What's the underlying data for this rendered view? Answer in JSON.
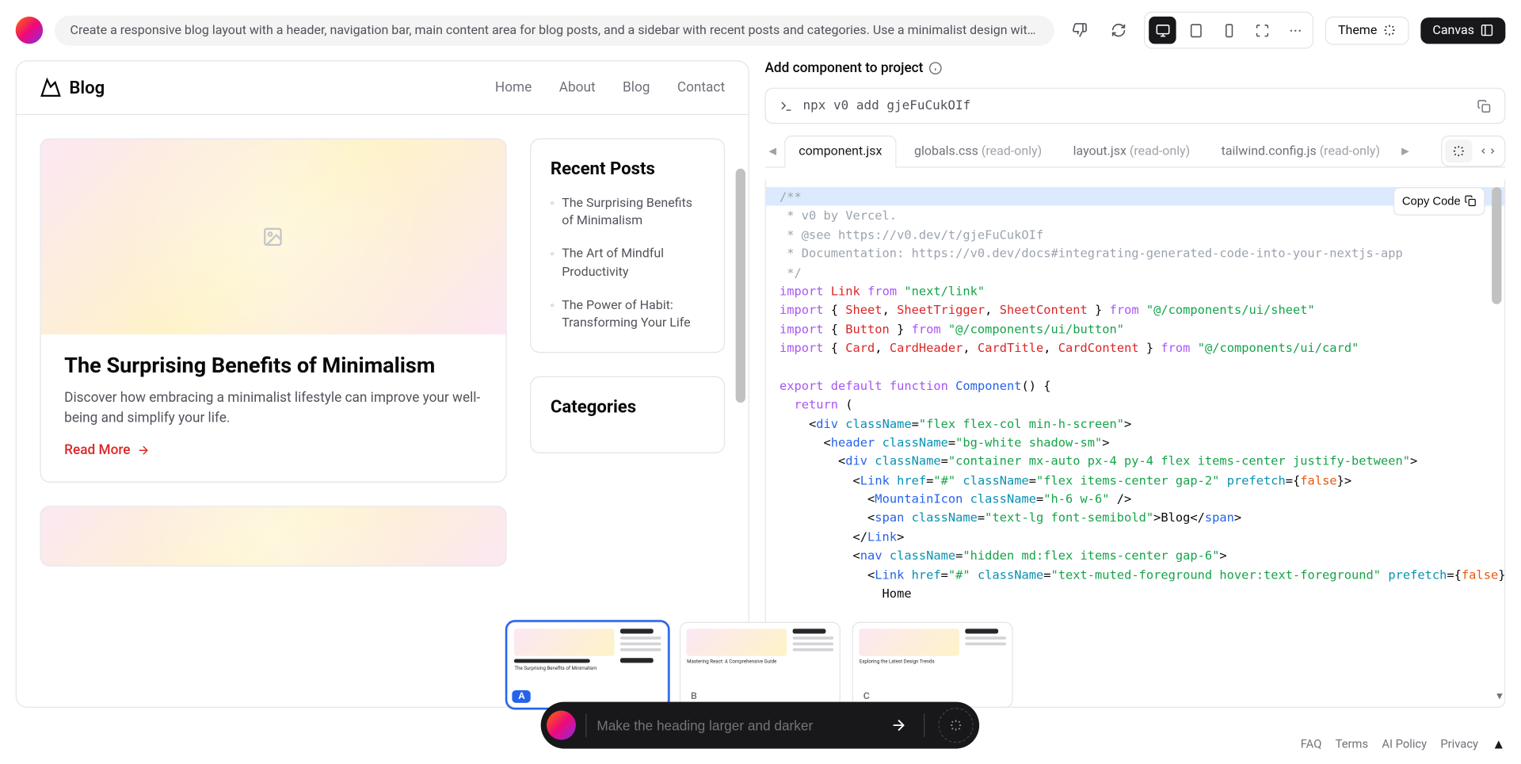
{
  "top": {
    "prompt": "Create a responsive blog layout with a header, navigation bar, main content area for blog posts, and a sidebar with recent posts and categories. Use a minimalist design with a whit…",
    "theme_label": "Theme",
    "canvas_label": "Canvas"
  },
  "preview": {
    "brand": "Blog",
    "nav": [
      "Home",
      "About",
      "Blog",
      "Contact"
    ],
    "post": {
      "title": "The Surprising Benefits of Minimalism",
      "excerpt": "Discover how embracing a minimalist lifestyle can improve your well-being and simplify your life.",
      "read_more": "Read More"
    },
    "recent_title": "Recent Posts",
    "recent": [
      "The Surprising Benefits of Minimalism",
      "The Art of Mindful Productivity",
      "The Power of Habit: Transforming Your Life"
    ],
    "categories_title": "Categories"
  },
  "code_panel": {
    "add_label": "Add component to project",
    "npx": "npx v0 add gjeFuCukOIf",
    "tabs": [
      {
        "name": "component.jsx",
        "ro": ""
      },
      {
        "name": "globals.css",
        "ro": "(read-only)"
      },
      {
        "name": "layout.jsx",
        "ro": "(read-only)"
      },
      {
        "name": "tailwind.config.js",
        "ro": "(read-only)"
      }
    ],
    "copy_label": "Copy Code"
  },
  "variants": {
    "labels": [
      "A",
      "B",
      "C"
    ],
    "titles": [
      "The Surprising Benefits of Minimalism",
      "Mastering React: A Comprehensive Guide",
      "Exploring the Latest Design Trends"
    ]
  },
  "chat": {
    "placeholder": "Make the heading larger and darker"
  },
  "footer": [
    "FAQ",
    "Terms",
    "AI Policy",
    "Privacy"
  ]
}
